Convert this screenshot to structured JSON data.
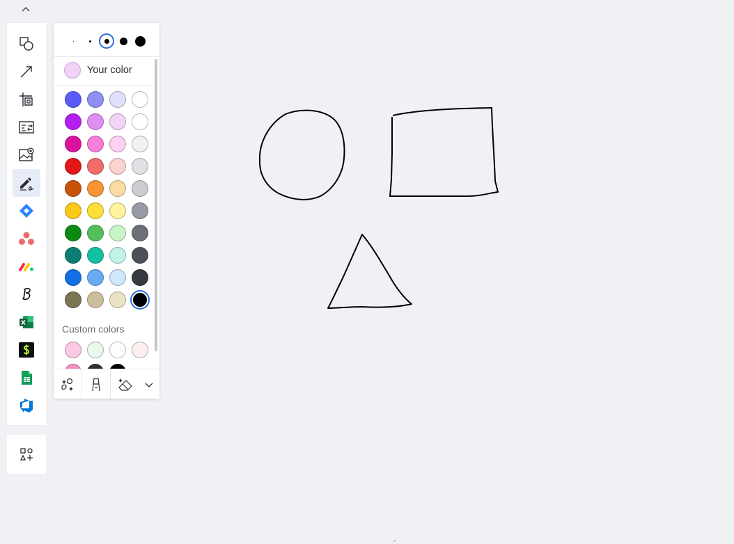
{
  "colors": {
    "accent": "#2f6bde",
    "background": "#f0f1f4",
    "active_tool_bg": "#e6ebf8"
  },
  "toolbar": {
    "collapse_icon": "chevron-up-icon",
    "tools": [
      {
        "id": "shapes",
        "icon": "shapes-icon",
        "active": false
      },
      {
        "id": "connection-line",
        "icon": "arrow-line-icon",
        "active": false
      },
      {
        "id": "frame",
        "icon": "frame-icon",
        "active": false
      },
      {
        "id": "templates",
        "icon": "templates-icon",
        "active": false
      },
      {
        "id": "image-upload",
        "icon": "image-upload-icon",
        "active": false
      },
      {
        "id": "pen",
        "icon": "pen-icon",
        "active": true
      },
      {
        "id": "jira",
        "icon": "jira-icon",
        "active": false
      },
      {
        "id": "asana",
        "icon": "asana-icon",
        "active": false
      },
      {
        "id": "monday",
        "icon": "monday-icon",
        "active": false
      },
      {
        "id": "brand",
        "icon": "script-b-icon",
        "active": false
      },
      {
        "id": "excel",
        "icon": "excel-icon",
        "active": false
      },
      {
        "id": "dollar-app",
        "icon": "dollar-app-icon",
        "active": false
      },
      {
        "id": "google-sheets",
        "icon": "google-sheets-icon",
        "active": false
      },
      {
        "id": "azure-devops",
        "icon": "azure-devops-icon",
        "active": false
      }
    ],
    "apps_icon": "add-apps-icon"
  },
  "pen_panel": {
    "stroke_sizes": [
      1,
      3,
      7,
      11,
      15
    ],
    "selected_size_index": 2,
    "your_color": {
      "label": "Your color",
      "color": "#f0d3f5"
    },
    "palette": [
      [
        "#5b5cf6",
        "#8f8ff3",
        "#dfe0f9",
        "#ffffff"
      ],
      [
        "#b51ef0",
        "#de8ff3",
        "#f3d3f6",
        "#ffffff"
      ],
      [
        "#d8149f",
        "#f77fdb",
        "#fad1f1",
        "#f0f1f3"
      ],
      [
        "#e31717",
        "#f46b6b",
        "#fbd2cf",
        "#e0e1e4"
      ],
      [
        "#c6520a",
        "#f99333",
        "#fcdaa4",
        "#cbcdd3"
      ],
      [
        "#fcc918",
        "#fedf3a",
        "#fff3a0",
        "#979aa2"
      ],
      [
        "#0a8a12",
        "#55bf5c",
        "#c8f5c6",
        "#6c7079"
      ],
      [
        "#0c7d72",
        "#12c0a2",
        "#bff3e8",
        "#4c5057"
      ],
      [
        "#1270e3",
        "#6aaaf5",
        "#cfe6fb",
        "#363a41"
      ],
      [
        "#7b7554",
        "#cbbf9b",
        "#ebe2c4",
        "#000000"
      ]
    ],
    "selected_color": "#000000",
    "custom_colors_label": "Custom colors",
    "custom_colors": [
      "#fbc8e3",
      "#e9f8ec",
      "#ffffff",
      "#fdeef0",
      "#f48fc6",
      "#2e3137",
      "#000000"
    ],
    "bottom_tools": [
      "shape-recognition-icon",
      "highlighter-icon",
      "smart-eraser-icon",
      "chevron-down-icon"
    ]
  },
  "canvas": {
    "drawings": [
      "circle",
      "rectangle",
      "triangle"
    ],
    "stroke_color": "#000000"
  }
}
